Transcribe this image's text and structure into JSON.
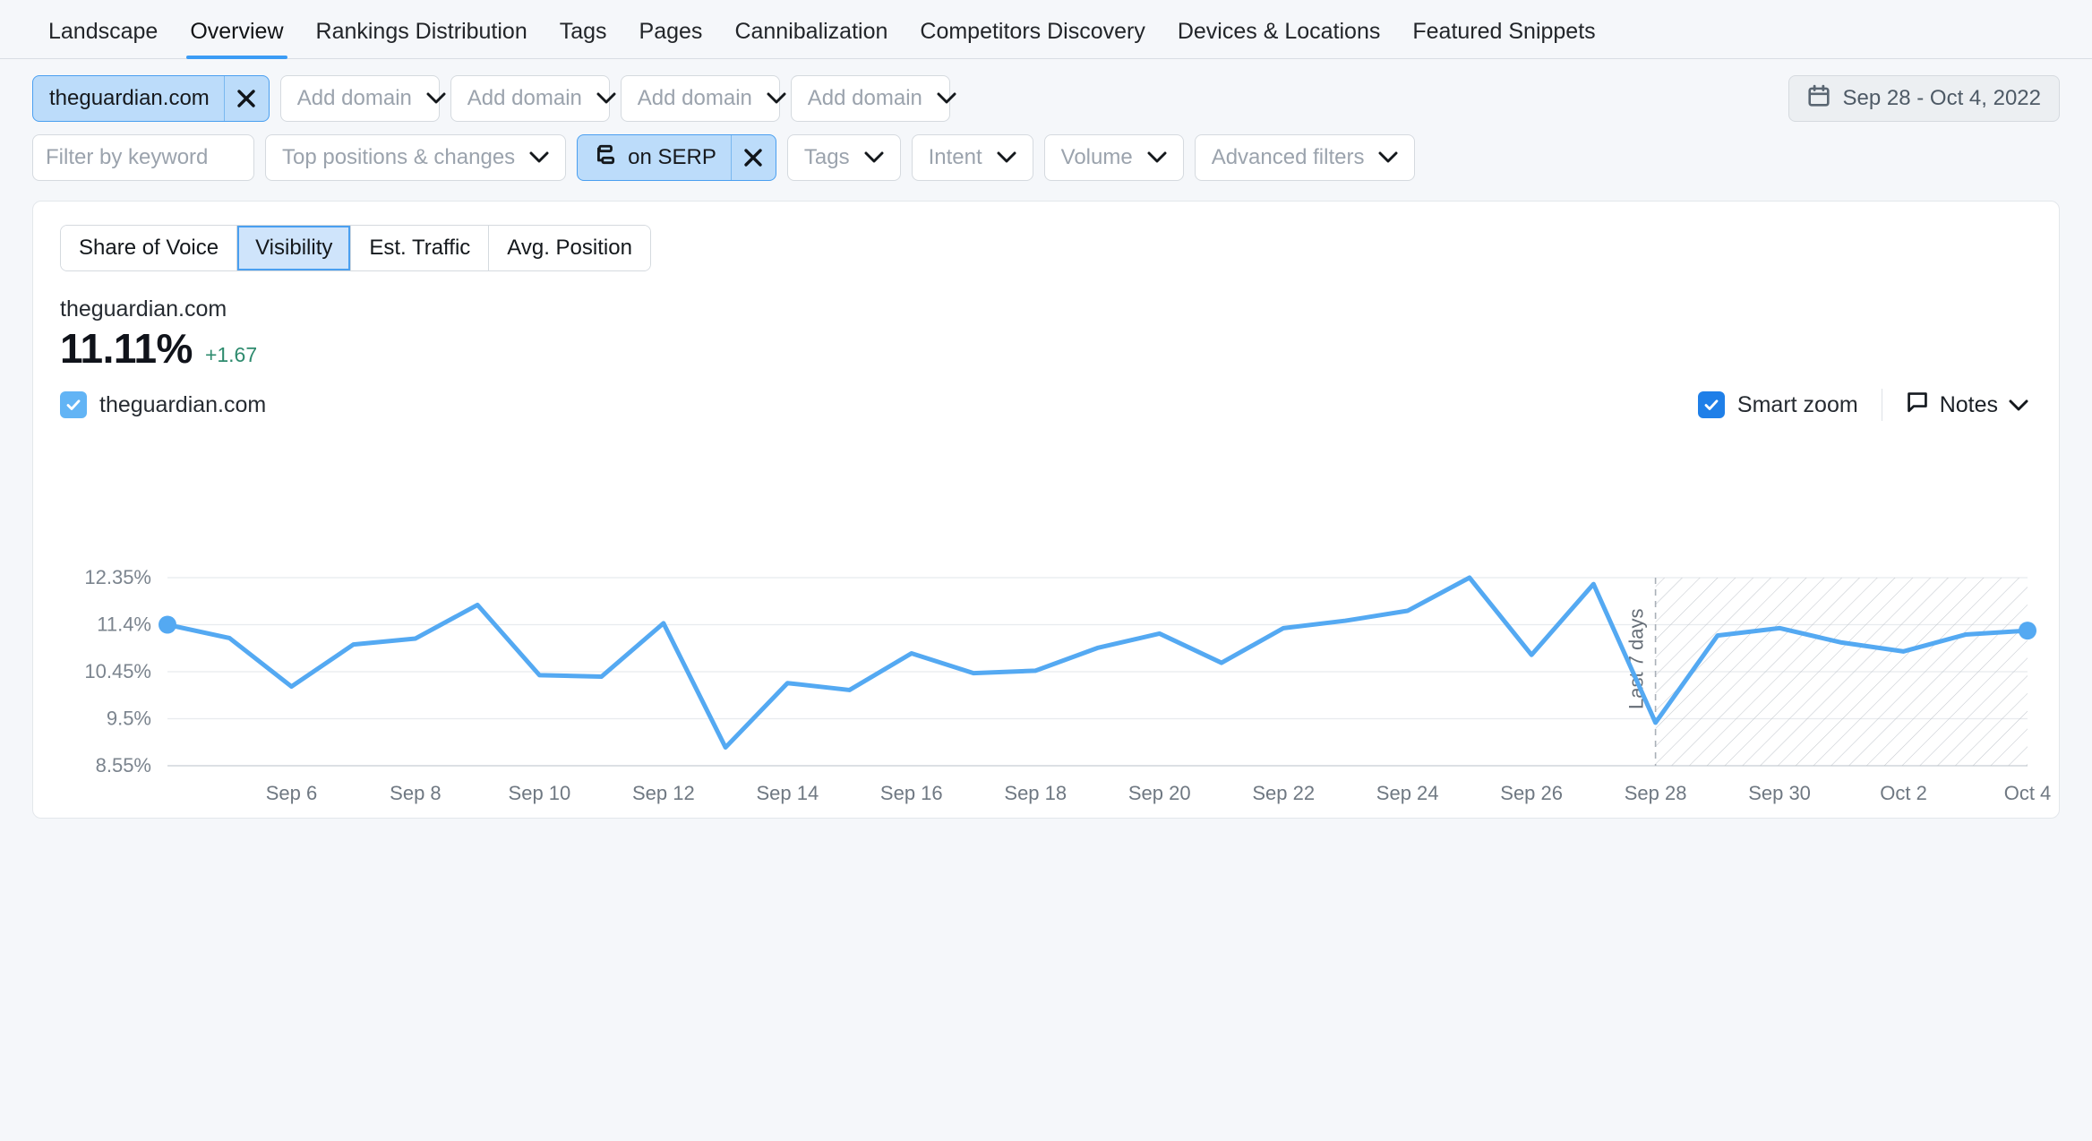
{
  "nav": {
    "tabs": [
      {
        "label": "Landscape",
        "active": false
      },
      {
        "label": "Overview",
        "active": true
      },
      {
        "label": "Rankings Distribution",
        "active": false
      },
      {
        "label": "Tags",
        "active": false
      },
      {
        "label": "Pages",
        "active": false
      },
      {
        "label": "Cannibalization",
        "active": false
      },
      {
        "label": "Competitors Discovery",
        "active": false
      },
      {
        "label": "Devices & Locations",
        "active": false
      },
      {
        "label": "Featured Snippets",
        "active": false
      }
    ]
  },
  "filters": {
    "domain_pill": "theguardian.com",
    "add_domain": "Add domain",
    "add_domain_count": 4,
    "date_range": "Sep 28 - Oct 4, 2022",
    "keyword_placeholder": "Filter by keyword",
    "keyword_value": "",
    "top_positions": "Top positions & changes",
    "on_serp": "on SERP",
    "tags": "Tags",
    "intent": "Intent",
    "volume": "Volume",
    "advanced": "Advanced filters"
  },
  "metric_tabs": [
    {
      "label": "Share of Voice",
      "active": false
    },
    {
      "label": "Visibility",
      "active": true
    },
    {
      "label": "Est. Traffic",
      "active": false
    },
    {
      "label": "Avg. Position",
      "active": false
    }
  ],
  "kpi": {
    "domain": "theguardian.com",
    "value": "11.11%",
    "delta": "+1.67",
    "delta_color": "#2e8b6e"
  },
  "legend": {
    "series_label": "theguardian.com",
    "smart_zoom_label": "Smart zoom",
    "smart_zoom_checked": true,
    "series_checked": true,
    "notes_label": "Notes"
  },
  "chart_data": {
    "type": "line",
    "title": "",
    "xlabel": "",
    "ylabel": "",
    "series": [
      {
        "name": "theguardian.com",
        "color": "#54a9f2",
        "values": [
          11.4,
          11.13,
          10.15,
          11.0,
          11.12,
          11.8,
          10.38,
          10.35,
          11.43,
          8.92,
          10.22,
          10.08,
          10.82,
          10.42,
          10.47,
          10.93,
          11.22,
          10.63,
          11.33,
          11.48,
          11.68,
          12.35,
          10.79,
          12.22,
          9.42,
          11.18,
          11.33,
          11.04,
          10.86,
          11.2,
          11.28
        ]
      }
    ],
    "x": [
      "Sep 4",
      "Sep 5",
      "Sep 6",
      "Sep 7",
      "Sep 8",
      "Sep 9",
      "Sep 10",
      "Sep 11",
      "Sep 12",
      "Sep 13",
      "Sep 14",
      "Sep 15",
      "Sep 16",
      "Sep 17",
      "Sep 18",
      "Sep 19",
      "Sep 20",
      "Sep 21",
      "Sep 22",
      "Sep 23",
      "Sep 24",
      "Sep 25",
      "Sep 26",
      "Sep 27",
      "Sep 28",
      "Sep 29",
      "Sep 30",
      "Oct 1",
      "Oct 2",
      "Oct 3",
      "Oct 4"
    ],
    "xtick_labels": [
      "Sep 6",
      "Sep 8",
      "Sep 10",
      "Sep 12",
      "Sep 14",
      "Sep 16",
      "Sep 18",
      "Sep 20",
      "Sep 22",
      "Sep 24",
      "Sep 26",
      "Sep 28",
      "Sep 30",
      "Oct 2",
      "Oct 4"
    ],
    "ytick_labels": [
      "12.35%",
      "11.4%",
      "10.45%",
      "9.5%",
      "8.55%"
    ],
    "ytick_values": [
      12.35,
      11.4,
      10.45,
      9.5,
      8.55
    ],
    "ylim": [
      8.55,
      12.35
    ],
    "grid": true,
    "legend_position": "top-left",
    "annotation": {
      "label": "Last 7 days",
      "at_x": "Sep 28",
      "shaded_region": true
    },
    "endpoint_markers": [
      {
        "x": "Sep 4",
        "y": 11.4
      },
      {
        "x": "Oct 4",
        "y": 11.28
      }
    ]
  }
}
